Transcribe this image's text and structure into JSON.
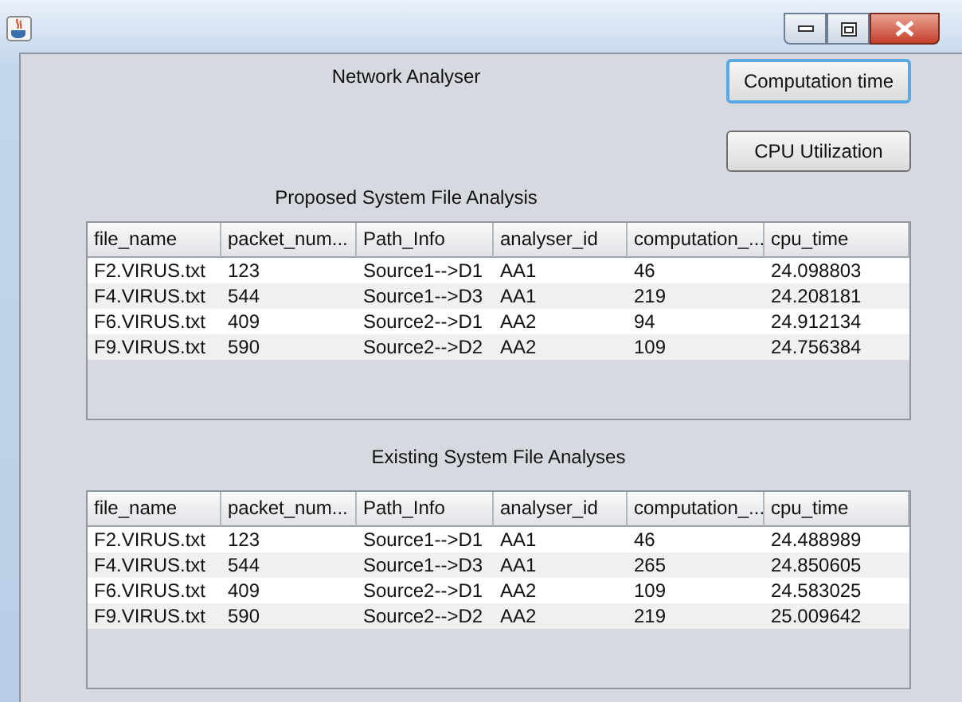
{
  "heading": "Network Analyser",
  "buttons": [
    {
      "label": "Computation time",
      "focused": true
    },
    {
      "label": "CPU Utilization",
      "focused": false
    }
  ],
  "tables": [
    {
      "caption": "Proposed System File Analysis",
      "columns": [
        "file_name",
        "packet_num...",
        "Path_Info",
        "analyser_id",
        "computation_...",
        "cpu_time"
      ],
      "rows": [
        [
          "F2.VIRUS.txt",
          "123",
          "Source1-->D1",
          "AA1",
          "46",
          "24.098803"
        ],
        [
          "F4.VIRUS.txt",
          "544",
          "Source1-->D3",
          "AA1",
          "219",
          "24.208181"
        ],
        [
          "F6.VIRUS.txt",
          "409",
          "Source2-->D1",
          "AA2",
          "94",
          "24.912134"
        ],
        [
          "F9.VIRUS.txt",
          "590",
          "Source2-->D2",
          "AA2",
          "109",
          "24.756384"
        ]
      ]
    },
    {
      "caption": "Existing System File Analyses",
      "columns": [
        "file_name",
        "packet_num...",
        "Path_Info",
        "analyser_id",
        "computation_...",
        "cpu_time"
      ],
      "rows": [
        [
          "F2.VIRUS.txt",
          "123",
          "Source1-->D1",
          "AA1",
          "46",
          "24.488989"
        ],
        [
          "F4.VIRUS.txt",
          "544",
          "Source1-->D3",
          "AA1",
          "265",
          "24.850605"
        ],
        [
          "F6.VIRUS.txt",
          "409",
          "Source2-->D1",
          "AA2",
          "109",
          "24.583025"
        ],
        [
          "F9.VIRUS.txt",
          "590",
          "Source2-->D2",
          "AA2",
          "219",
          "25.009642"
        ]
      ]
    }
  ]
}
